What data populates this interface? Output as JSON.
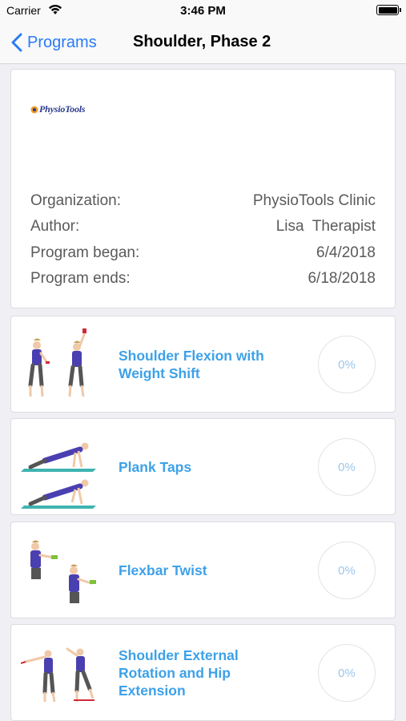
{
  "status_bar": {
    "carrier": "Carrier",
    "time": "3:46 PM"
  },
  "nav": {
    "back_label": "Programs",
    "title": "Shoulder, Phase 2"
  },
  "program": {
    "logo_text": "PhysioTools",
    "details": [
      {
        "label": "Organization:",
        "value": "PhysioTools Clinic"
      },
      {
        "label": "Author:",
        "value": "Lisa  Therapist"
      },
      {
        "label": "Program began:",
        "value": "6/4/2018"
      },
      {
        "label": "Program ends:",
        "value": "6/18/2018"
      }
    ]
  },
  "exercises": [
    {
      "title": "Shoulder Flexion with Weight Shift",
      "progress": "0%"
    },
    {
      "title": "Plank Taps",
      "progress": "0%"
    },
    {
      "title": "Flexbar Twist",
      "progress": "0%"
    },
    {
      "title": "Shoulder External Rotation and Hip Extension",
      "progress": "0%"
    }
  ],
  "colors": {
    "accent": "#2a7bf6",
    "exercise_title": "#3da1e8",
    "progress_text": "#9cc6ec"
  }
}
